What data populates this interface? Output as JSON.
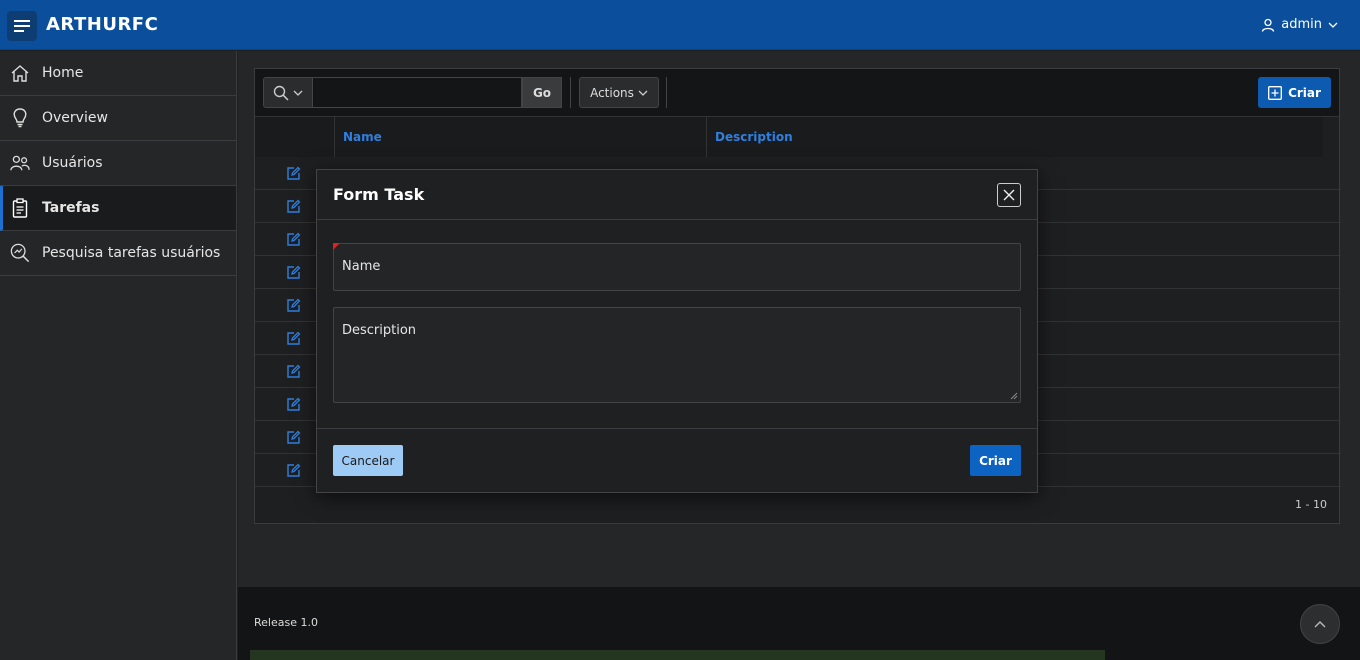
{
  "app": {
    "title": "ARTHURFC",
    "user": "admin"
  },
  "sidebar": {
    "items": [
      {
        "label": "Home",
        "icon": "home-icon"
      },
      {
        "label": "Overview",
        "icon": "lightbulb-icon"
      },
      {
        "label": "Usuários",
        "icon": "users-icon"
      },
      {
        "label": "Tarefas",
        "icon": "clipboard-icon",
        "active": true
      },
      {
        "label": "Pesquisa tarefas usuários",
        "icon": "search-chart-icon"
      }
    ]
  },
  "toolbar": {
    "go_label": "Go",
    "actions_label": "Actions",
    "create_label": "Criar",
    "search_value": ""
  },
  "table": {
    "columns": [
      "Name",
      "Description"
    ],
    "row_count": 10,
    "pagination": "1 - 10"
  },
  "dialog": {
    "title": "Form Task",
    "fields": [
      {
        "label": "Name",
        "value": "",
        "required": true
      },
      {
        "label": "Description",
        "value": ""
      }
    ],
    "cancel_label": "Cancelar",
    "submit_label": "Criar"
  },
  "footer": {
    "release": "Release 1.0"
  },
  "colors": {
    "header": "#0b4f9c",
    "accent": "#2f7fe0",
    "button": "#0d63c2",
    "cancel": "#9ecbf5",
    "required": "#e02020"
  }
}
